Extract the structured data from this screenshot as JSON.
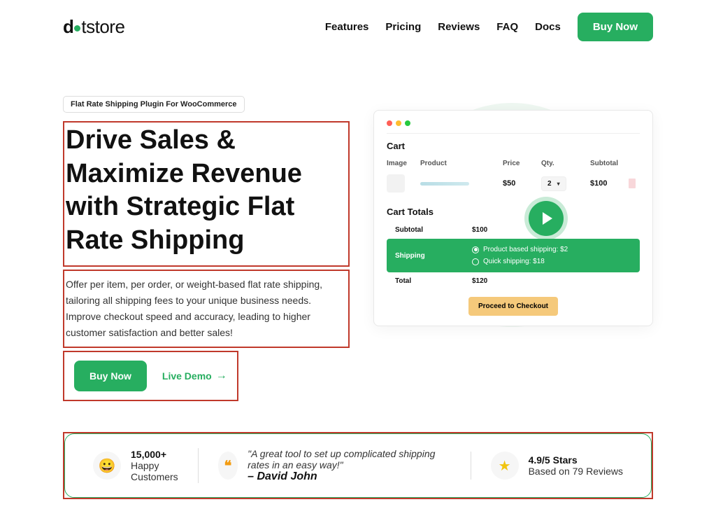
{
  "header": {
    "logo_prefix": "d",
    "logo_suffix": "tstore",
    "nav": [
      "Features",
      "Pricing",
      "Reviews",
      "FAQ",
      "Docs"
    ],
    "cta": "Buy Now"
  },
  "hero": {
    "tag": "Flat Rate Shipping Plugin For WooCommerce",
    "title": "Drive Sales & Maximize Revenue with Strategic Flat Rate Shipping",
    "desc": "Offer per item, per order, or weight-based flat rate shipping, tailoring all shipping fees to your unique business needs. Improve checkout speed and accuracy, leading to higher customer satisfaction and better sales!",
    "buy": "Buy Now",
    "demo": "Live Demo"
  },
  "cart": {
    "title": "Cart",
    "headers": {
      "image": "Image",
      "product": "Product",
      "price": "Price",
      "qty": "Qty.",
      "subtotal": "Subtotal"
    },
    "row": {
      "price": "$50",
      "qty": "2",
      "subtotal": "$100"
    },
    "totals_title": "Cart Totals",
    "subtotal_label": "Subtotal",
    "subtotal_val": "$100",
    "shipping_label": "Shipping",
    "ship_opt1": "Product based shipping: $2",
    "ship_opt2": "Quick shipping: $18",
    "total_label": "Total",
    "total_val": "$120",
    "checkout": "Proceed to Checkout"
  },
  "stats": {
    "customers_count": "15,000+",
    "customers_l1": "Happy",
    "customers_l2": "Customers",
    "quote": "\"A great tool to set up complicated shipping rates in an easy way!\"",
    "author": "– David John",
    "rating_title": "4.9/5 Stars",
    "rating_sub": "Based on 79 Reviews"
  }
}
